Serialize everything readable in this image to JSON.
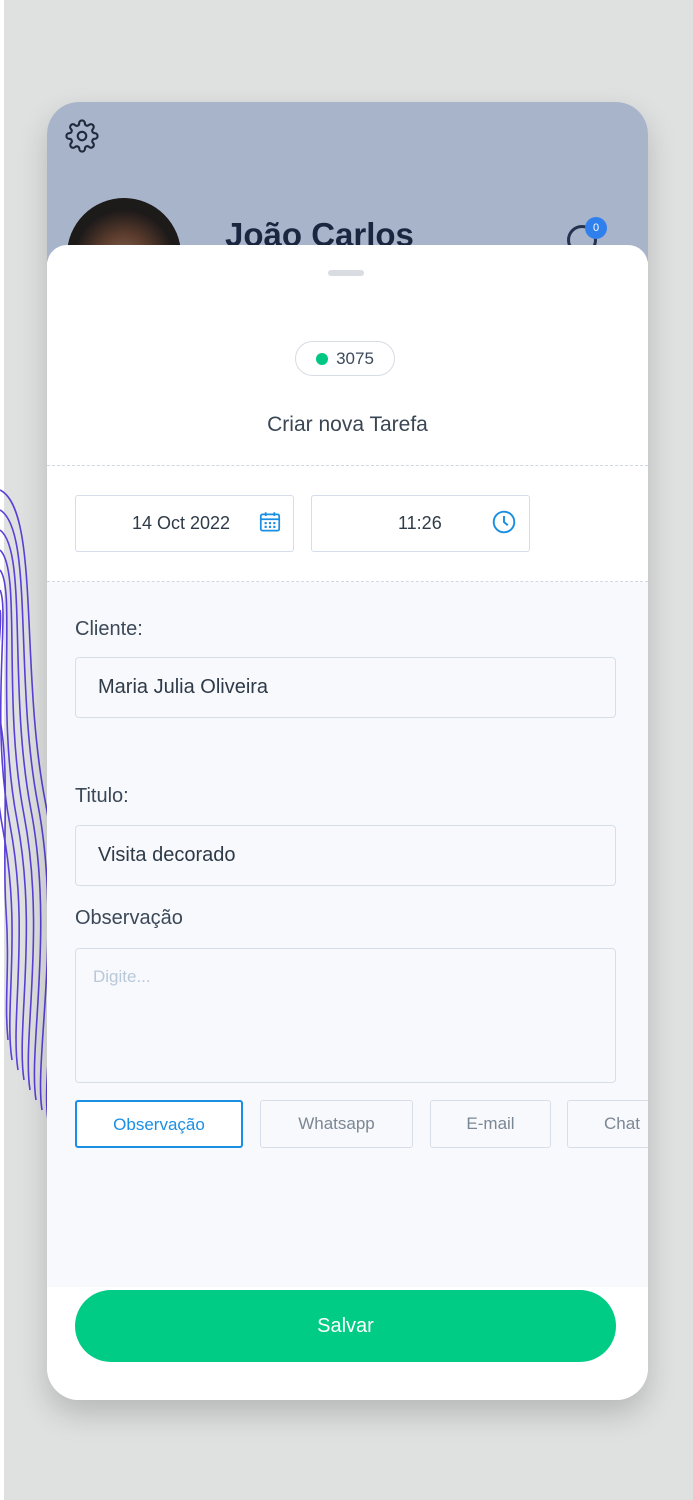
{
  "header": {
    "user_name": "João Carlos",
    "notification_count": "0"
  },
  "task": {
    "code": "3075",
    "status_color": "#00c882",
    "title": "Criar nova Tarefa",
    "date": "14 Oct 2022",
    "time": "11:26"
  },
  "form": {
    "client_label": "Cliente:",
    "client_value": "Maria Julia Oliveira",
    "title_label": "Titulo:",
    "title_value": "Visita decorado",
    "notes_label": "Observação",
    "notes_placeholder": "Digite..."
  },
  "channels": [
    {
      "label": "Observação",
      "active": true
    },
    {
      "label": "Whatsapp",
      "active": false
    },
    {
      "label": "E-mail",
      "active": false
    },
    {
      "label": "Chat",
      "active": false
    }
  ],
  "actions": {
    "save_label": "Salvar"
  },
  "colors": {
    "header_bg": "#a8b4c9",
    "accent_blue": "#1a8fe3",
    "primary_green": "#00cc85"
  },
  "icons": {
    "settings": "gear-icon",
    "calendar": "calendar-icon",
    "clock": "clock-icon",
    "notification": "bell-icon"
  }
}
